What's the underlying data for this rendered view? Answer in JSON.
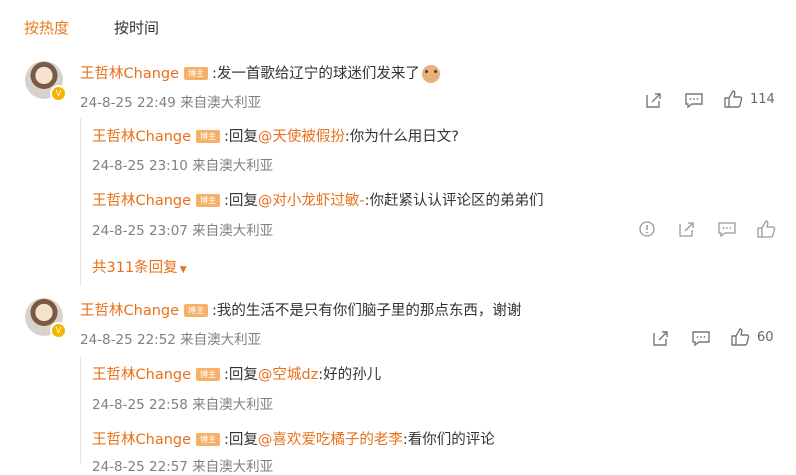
{
  "tabs": {
    "hot": "按热度",
    "time": "按时间"
  },
  "comments": [
    {
      "user": "王哲林Change",
      "badge": "博主",
      "text": ":发一首歌给辽宁的球迷们发来了",
      "meta": "24-8-25 22:49 来自澳大利亚",
      "likes": "114",
      "replies": [
        {
          "user": "王哲林Change",
          "badge": "博主",
          "prefix": ":回复",
          "mention": "@天使被假扮",
          "text": ":你为什么用日文?",
          "meta": "24-8-25 23:10 来自澳大利亚"
        },
        {
          "user": "王哲林Change",
          "badge": "博主",
          "prefix": ":回复",
          "mention": "@对小龙虾过敏-",
          "text": ":你赶紧认认评论区的弟弟们",
          "meta": "24-8-25 23:07 来自澳大利亚"
        }
      ],
      "more": "共311条回复"
    },
    {
      "user": "王哲林Change",
      "badge": "博主",
      "text": ":我的生活不是只有你们脑子里的那点东西，谢谢",
      "meta": "24-8-25 22:52 来自澳大利亚",
      "likes": "60",
      "replies": [
        {
          "user": "王哲林Change",
          "badge": "博主",
          "prefix": ":回复",
          "mention": "@空城dz",
          "text": ":好的孙儿",
          "meta": "24-8-25 22:58 来自澳大利亚"
        },
        {
          "user": "王哲林Change",
          "badge": "博主",
          "prefix": ":回复",
          "mention": "@喜欢爱吃橘子的老李",
          "text": ":看你们的评论",
          "meta": "24-8-25 22:57 来自澳大利亚"
        }
      ]
    }
  ]
}
